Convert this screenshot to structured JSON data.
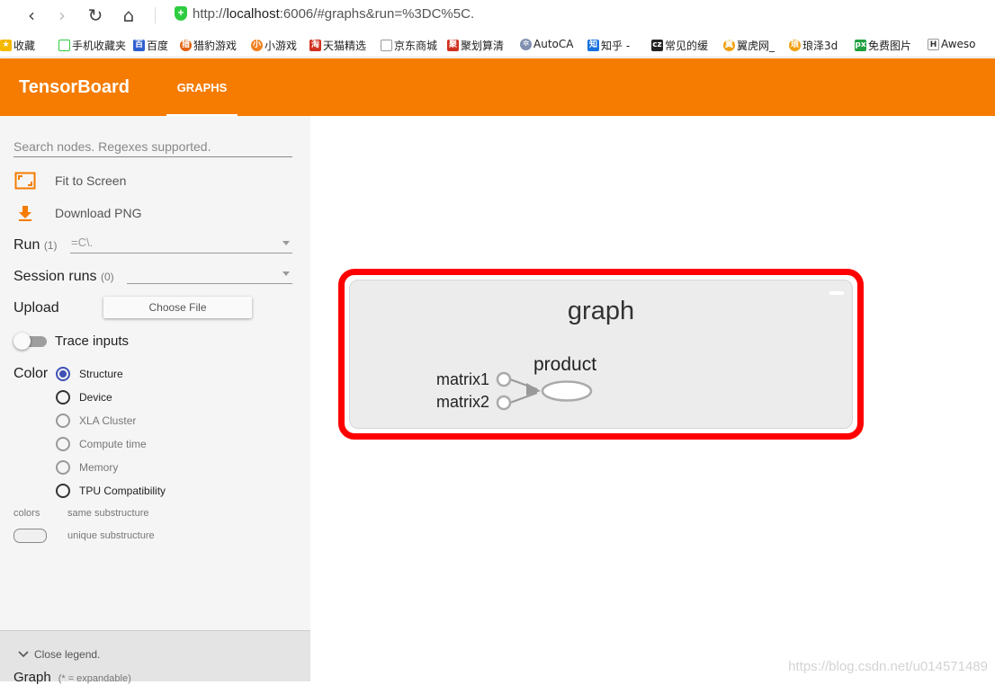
{
  "browser": {
    "url_prefix": "http://",
    "url_host": "localhost",
    "url_rest": ":6006/#graphs&run=%3DC%5C.",
    "back_icon": "back-icon",
    "forward_icon": "forward-icon",
    "refresh_icon": "refresh-icon",
    "home_icon": "home-icon",
    "secure_icon": "shield-icon"
  },
  "bookmarks": [
    "收藏",
    "手机收藏夹",
    "百度",
    "猎豹游戏",
    "小游戏",
    "天猫精选",
    "京东商城",
    "聚划算清",
    "AutoCA",
    "知乎 -",
    "常见的缓",
    "翼虎网_",
    "琅泽3d",
    "免费图片",
    "Aweso"
  ],
  "header": {
    "title": "TensorBoard",
    "tab": "GRAPHS",
    "accent": "#f57c00"
  },
  "sidebar": {
    "search_placeholder": "Search nodes. Regexes supported.",
    "fit_to_screen": "Fit to Screen",
    "download_png": "Download PNG",
    "run_label": "Run",
    "run_count": "(1)",
    "run_value": "=C\\.",
    "session_label": "Session runs",
    "session_count": "(0)",
    "upload_label": "Upload",
    "choose_file": "Choose File",
    "trace_inputs": "Trace inputs",
    "color_label": "Color",
    "color_options": [
      "Structure",
      "Device",
      "XLA Cluster",
      "Compute time",
      "Memory",
      "TPU Compatibility"
    ],
    "selected_color": "Structure",
    "colors_label": "colors",
    "same_substructure": "same substructure",
    "unique_substructure": "unique substructure",
    "close_legend": "Close legend.",
    "graph_label": "Graph",
    "expandable_note": "(* = expandable)"
  },
  "graph": {
    "title": "graph",
    "nodes": {
      "input1": "matrix1",
      "input2": "matrix2",
      "op": "product"
    },
    "highlight_color": "#ff0000"
  },
  "watermark": "https://blog.csdn.net/u014571489"
}
